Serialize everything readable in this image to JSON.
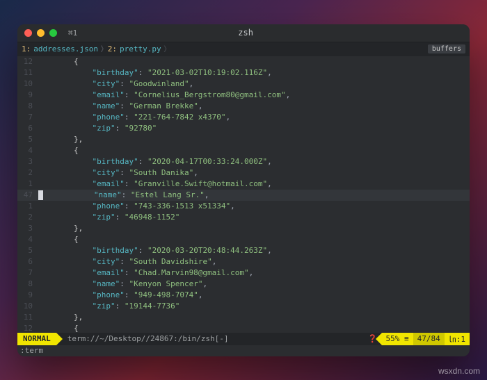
{
  "window": {
    "tab_label": "⌘1",
    "title": "zsh"
  },
  "bufferline": {
    "buffers": [
      {
        "num": "1:",
        "name": "addresses.json"
      },
      {
        "num": "2:",
        "name": "pretty.py"
      }
    ],
    "label": "buffers"
  },
  "editor": {
    "cursor_line_abs": "47",
    "lines": [
      {
        "rel": "12",
        "indent": 8,
        "type": "brace",
        "text": "{"
      },
      {
        "rel": "11",
        "indent": 12,
        "type": "kv",
        "key": "birthday",
        "val": "2021-03-02T10:19:02.116Z",
        "comma": true
      },
      {
        "rel": "10",
        "indent": 12,
        "type": "kv",
        "key": "city",
        "val": "Goodwinland",
        "comma": true
      },
      {
        "rel": "9",
        "indent": 12,
        "type": "kv",
        "key": "email",
        "val": "Cornelius_Bergstrom80@gmail.com",
        "comma": true
      },
      {
        "rel": "8",
        "indent": 12,
        "type": "kv",
        "key": "name",
        "val": "German Brekke",
        "comma": true
      },
      {
        "rel": "7",
        "indent": 12,
        "type": "kv",
        "key": "phone",
        "val": "221-764-7842 x4370",
        "comma": true
      },
      {
        "rel": "6",
        "indent": 12,
        "type": "kv",
        "key": "zip",
        "val": "92780",
        "comma": false
      },
      {
        "rel": "5",
        "indent": 8,
        "type": "brace",
        "text": "},"
      },
      {
        "rel": "4",
        "indent": 8,
        "type": "brace",
        "text": "{"
      },
      {
        "rel": "3",
        "indent": 12,
        "type": "kv",
        "key": "birthday",
        "val": "2020-04-17T00:33:24.000Z",
        "comma": true
      },
      {
        "rel": "2",
        "indent": 12,
        "type": "kv",
        "key": "city",
        "val": "South Danika",
        "comma": true
      },
      {
        "rel": "1",
        "indent": 12,
        "type": "kv",
        "key": "email",
        "val": "Granville.Swift@hotmail.com",
        "comma": true
      },
      {
        "rel": "47",
        "indent": 12,
        "type": "kv",
        "key": "name",
        "val": "Estel Lang Sr.",
        "comma": true,
        "cursor": true
      },
      {
        "rel": "1",
        "indent": 12,
        "type": "kv",
        "key": "phone",
        "val": "743-336-1513 x51334",
        "comma": true
      },
      {
        "rel": "2",
        "indent": 12,
        "type": "kv",
        "key": "zip",
        "val": "46948-1152",
        "comma": false
      },
      {
        "rel": "3",
        "indent": 8,
        "type": "brace",
        "text": "},"
      },
      {
        "rel": "4",
        "indent": 8,
        "type": "brace",
        "text": "{"
      },
      {
        "rel": "5",
        "indent": 12,
        "type": "kv",
        "key": "birthday",
        "val": "2020-03-20T20:48:44.263Z",
        "comma": true
      },
      {
        "rel": "6",
        "indent": 12,
        "type": "kv",
        "key": "city",
        "val": "South Davidshire",
        "comma": true
      },
      {
        "rel": "7",
        "indent": 12,
        "type": "kv",
        "key": "email",
        "val": "Chad.Marvin98@gmail.com",
        "comma": true
      },
      {
        "rel": "8",
        "indent": 12,
        "type": "kv",
        "key": "name",
        "val": "Kenyon Spencer",
        "comma": true
      },
      {
        "rel": "9",
        "indent": 12,
        "type": "kv",
        "key": "phone",
        "val": "949-498-7074",
        "comma": true
      },
      {
        "rel": "10",
        "indent": 12,
        "type": "kv",
        "key": "zip",
        "val": "19144-7736",
        "comma": false
      },
      {
        "rel": "11",
        "indent": 8,
        "type": "brace",
        "text": "},"
      },
      {
        "rel": "12",
        "indent": 8,
        "type": "brace",
        "text": "{"
      }
    ]
  },
  "statusline": {
    "mode": "NORMAL",
    "path": "term://~/Desktop//24867:/bin/zsh[-]",
    "percent": "55%",
    "linesep": "≡",
    "rowcol": "47/84",
    "colinfo": "㏑:1"
  },
  "cmdline": ":term",
  "watermark": "wsxdn.com"
}
